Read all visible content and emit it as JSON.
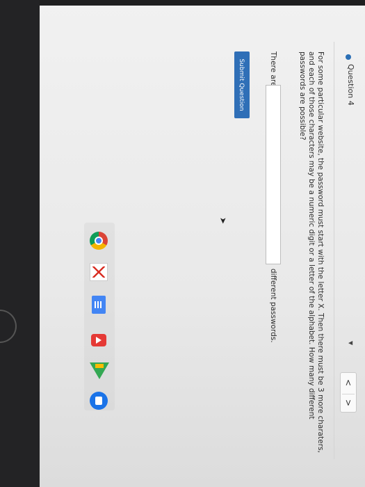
{
  "question": {
    "title": "Question 4",
    "dropdown_icon": "caret-down-icon",
    "nav": {
      "prev": "<",
      "next": ">"
    },
    "text": "For some particular website, the password must start with the letter X. Then there must be 3 more charaters, and each of those characters may be a numeric digit or a letter of the alphabet. How many different passwords are possible?",
    "answer": {
      "prefix": "There are",
      "value": "",
      "placeholder": "",
      "suffix": "different passwords."
    },
    "submit_label": "Submit Question"
  },
  "dock": {
    "icons": [
      "chrome-icon",
      "gmail-icon",
      "docs-icon",
      "youtube-icon",
      "drive-icon",
      "files-icon"
    ]
  },
  "colors": {
    "accent": "#2f6fb7",
    "status_dot": "#2b6fb5"
  }
}
